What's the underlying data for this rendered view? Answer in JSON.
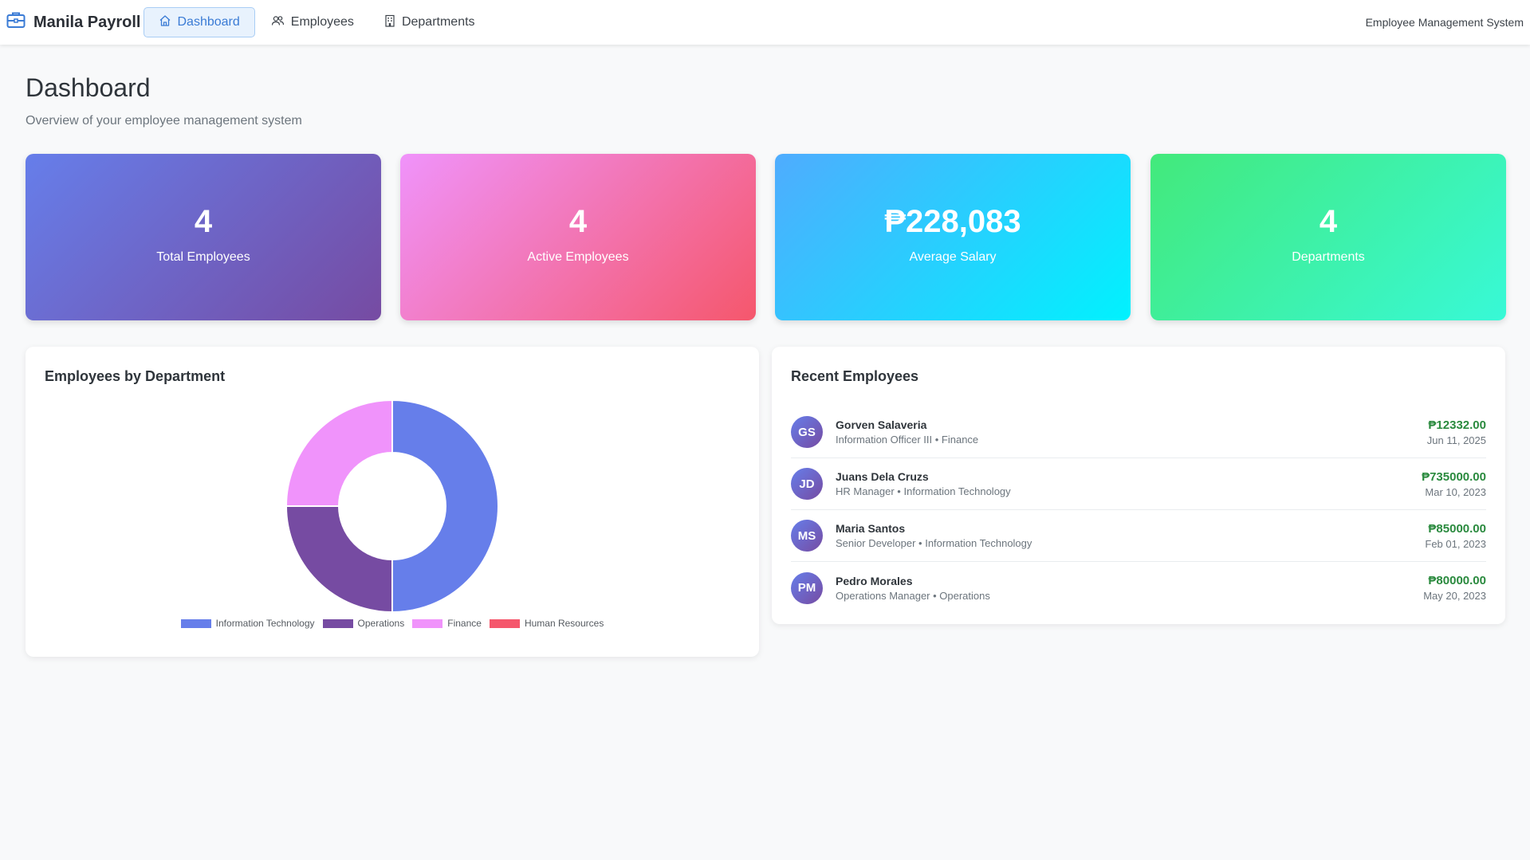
{
  "nav": {
    "brand": "Manila Payroll",
    "links": [
      {
        "label": "Dashboard",
        "icon": "home-icon",
        "active": true
      },
      {
        "label": "Employees",
        "icon": "people-icon",
        "active": false
      },
      {
        "label": "Departments",
        "icon": "building-icon",
        "active": false
      }
    ],
    "right_text": "Employee Management System"
  },
  "header": {
    "title": "Dashboard",
    "subtitle": "Overview of your employee management system"
  },
  "stats": [
    {
      "value": "4",
      "label": "Total Employees"
    },
    {
      "value": "4",
      "label": "Active Employees"
    },
    {
      "value": "₱228,083",
      "label": "Average Salary"
    },
    {
      "value": "4",
      "label": "Departments"
    }
  ],
  "chart_panel": {
    "title": "Employees by Department"
  },
  "chart_data": {
    "type": "pie",
    "categories": [
      "Information Technology",
      "Operations",
      "Finance",
      "Human Resources"
    ],
    "values": [
      2,
      1,
      1,
      0
    ],
    "colors": [
      "#667eea",
      "#764ba2",
      "#f093fb",
      "#f5576c"
    ],
    "legend": "bottom"
  },
  "recent": {
    "title": "Recent Employees",
    "employees": [
      {
        "initials": "GS",
        "name": "Gorven Salaveria",
        "meta": "Information Officer III • Finance",
        "salary": "₱12332.00",
        "date": "Jun 11, 2025"
      },
      {
        "initials": "JD",
        "name": "Juans Dela Cruzs",
        "meta": "HR Manager • Information Technology",
        "salary": "₱735000.00",
        "date": "Mar 10, 2023"
      },
      {
        "initials": "MS",
        "name": "Maria Santos",
        "meta": "Senior Developer • Information Technology",
        "salary": "₱85000.00",
        "date": "Feb 01, 2023"
      },
      {
        "initials": "PM",
        "name": "Pedro Morales",
        "meta": "Operations Manager • Operations",
        "salary": "₱80000.00",
        "date": "May 20, 2023"
      }
    ]
  }
}
